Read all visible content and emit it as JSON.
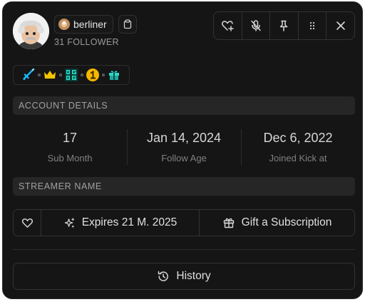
{
  "user": {
    "username": "berliner",
    "followers": "31 FOLLOWER"
  },
  "actions": [
    {
      "icon": "heart-plus-icon"
    },
    {
      "icon": "mic-off-icon"
    },
    {
      "icon": "pin-icon"
    },
    {
      "icon": "more-dots-icon"
    },
    {
      "icon": "close-icon"
    }
  ],
  "badges": [
    {
      "icon": "sword-icon",
      "color": "#19b8ff"
    },
    {
      "icon": "crown-icon",
      "color": "#f5c400"
    },
    {
      "icon": "og-badge-icon",
      "color": "#2fe0c8"
    },
    {
      "icon": "number-one-icon",
      "color": "#f5b800"
    },
    {
      "icon": "gift-badge-icon",
      "color": "#2fd6c8"
    }
  ],
  "account": {
    "header": "ACCOUNT DETAILS",
    "stats": [
      {
        "value": "17",
        "label": "Sub Month"
      },
      {
        "value": "Jan 14, 2024",
        "label": "Follow Age"
      },
      {
        "value": "Dec 6, 2022",
        "label": "Joined Kick at"
      }
    ]
  },
  "streamer": {
    "header": "STREAMER NAME"
  },
  "subscription": {
    "expires_label": "Expires 21 M. 2025",
    "gift_label": "Gift a Subscription"
  },
  "history": {
    "label": "History"
  }
}
